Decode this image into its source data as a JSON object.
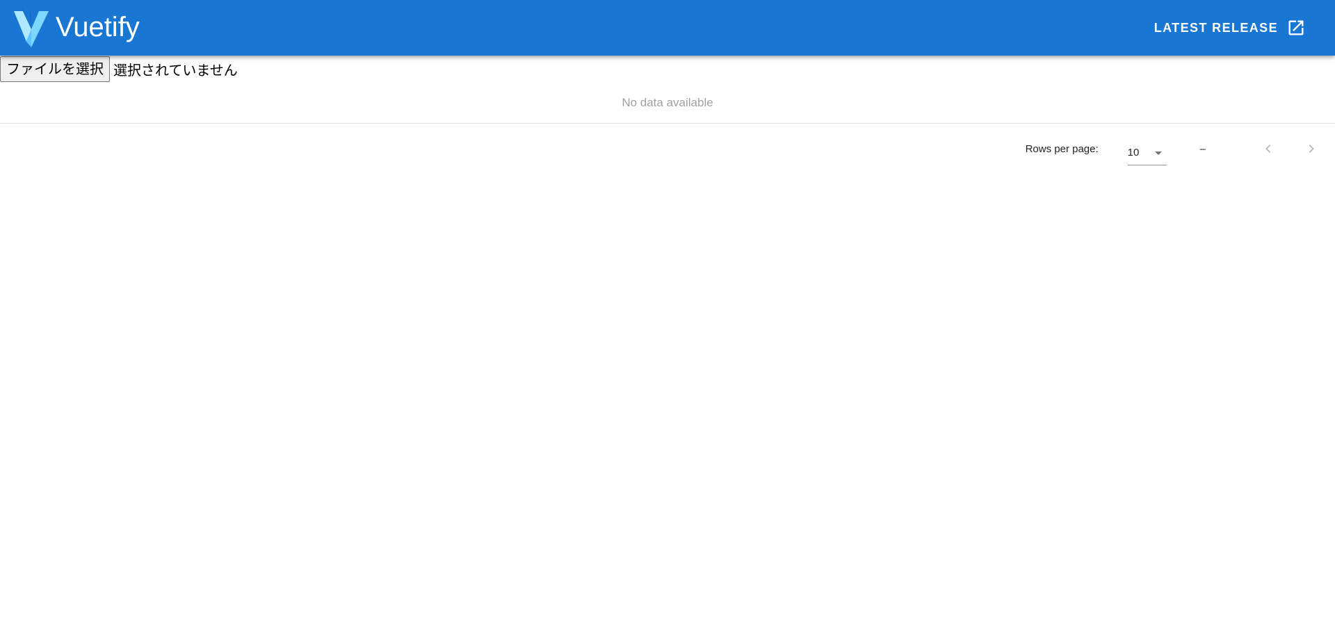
{
  "app_bar": {
    "brand": "Vuetify",
    "release_label": "LATEST RELEASE",
    "background": "#1976d2",
    "icons": {
      "logo": "vuetify-logo",
      "release": "open-in-new-icon"
    }
  },
  "file_input": {
    "button_label": "ファイルを選択",
    "status_text": "選択されていません"
  },
  "table": {
    "no_data_text": "No data available",
    "footer": {
      "rows_per_page_label": "Rows per page:",
      "rows_per_page_value": "10",
      "page_range": "–",
      "icons": {
        "dropdown": "menu-down-icon",
        "previous": "chevron-left-icon",
        "next": "chevron-right-icon"
      }
    }
  }
}
